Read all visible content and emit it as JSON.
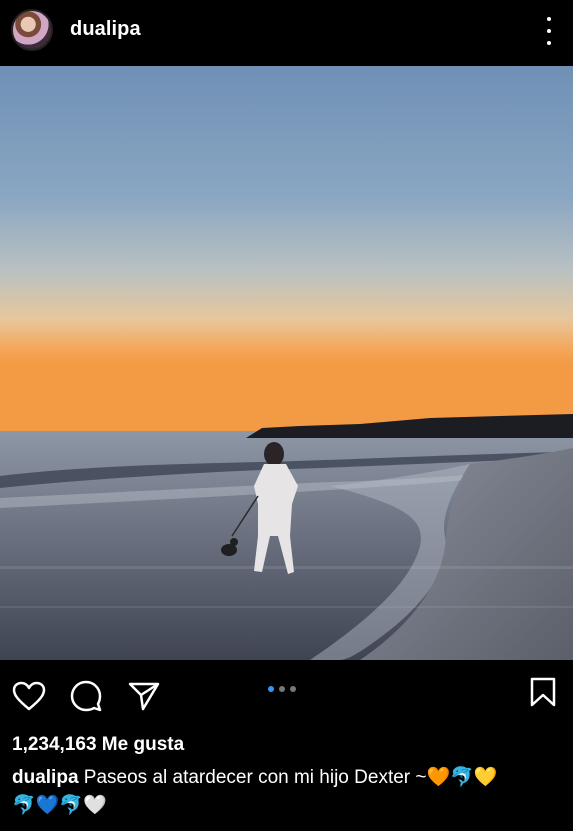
{
  "post": {
    "username": "dualipa",
    "likes_text": "1,234,163 Me gusta",
    "caption_user": "dualipa",
    "caption_text": "Paseos al atardecer con mi hijo Dexter ~",
    "caption_emojis_line1": "🧡🐬💛",
    "caption_emojis_line2": "🐬💙🐬🤍"
  },
  "carousel": {
    "total": 3,
    "current": 1
  },
  "colors": {
    "background": "#000000",
    "accent": "#3897f0",
    "text": "#ffffff"
  },
  "icons": [
    "heart-icon",
    "comment-icon",
    "share-icon",
    "bookmark-icon",
    "more-options-icon"
  ]
}
